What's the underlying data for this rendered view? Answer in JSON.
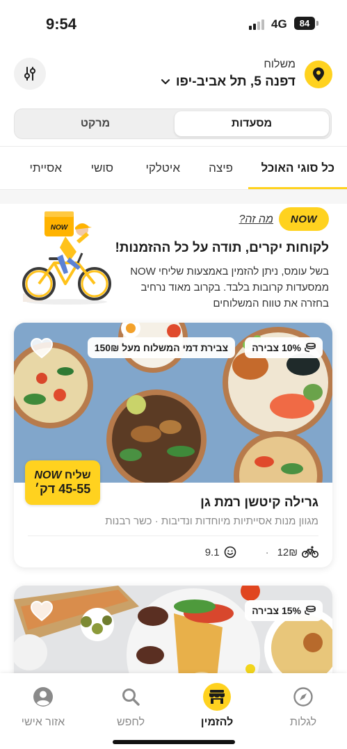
{
  "status": {
    "time": "9:54",
    "network": "4G",
    "battery": "84"
  },
  "header": {
    "delivery_label": "משלוח",
    "address": "דפנה 5, תל אביב-יפו"
  },
  "segmented": {
    "active": "מסעדות",
    "inactive": "מרקט"
  },
  "categories": [
    "כל סוגי האוכל",
    "פיצה",
    "איטלקי",
    "סושי",
    "אסייתי"
  ],
  "promo": {
    "badge": "NOW",
    "link": "מה זה?",
    "title": "לקוחות יקרים, תודה על כל ההזמנות!",
    "text": "בשל עומס, ניתן להזמין באמצעות שליחי NOW ממסעדות קרובות בלבד. בקרוב מאוד נרחיב בחזרה את טווח המשלוחים"
  },
  "restaurants": [
    {
      "badge_points": "10% צבירה",
      "badge_offer": "צבירת דמי המשלוח מעל 150₪",
      "now_delivery_line1": "שליח",
      "now_delivery_brand": "NOW",
      "now_delivery_line2": "45-55 דק׳",
      "name": "גרילה קיטשן רמת גן",
      "description": "מגוון מנות אסייתיות מיוחדות ונדיבות · כשר רבנות",
      "delivery_fee": "12₪",
      "separator": "·",
      "rating": "9.1"
    },
    {
      "badge_points": "15% צבירה"
    }
  ],
  "bottom_nav": [
    {
      "label": "לגלות",
      "icon": "compass-icon"
    },
    {
      "label": "להזמין",
      "icon": "store-icon"
    },
    {
      "label": "לחפש",
      "icon": "search-icon"
    },
    {
      "label": "אזור אישי",
      "icon": "user-icon"
    }
  ],
  "colors": {
    "accent": "#ffd21f",
    "text": "#1b1b1b",
    "muted": "#8a8a8a"
  }
}
